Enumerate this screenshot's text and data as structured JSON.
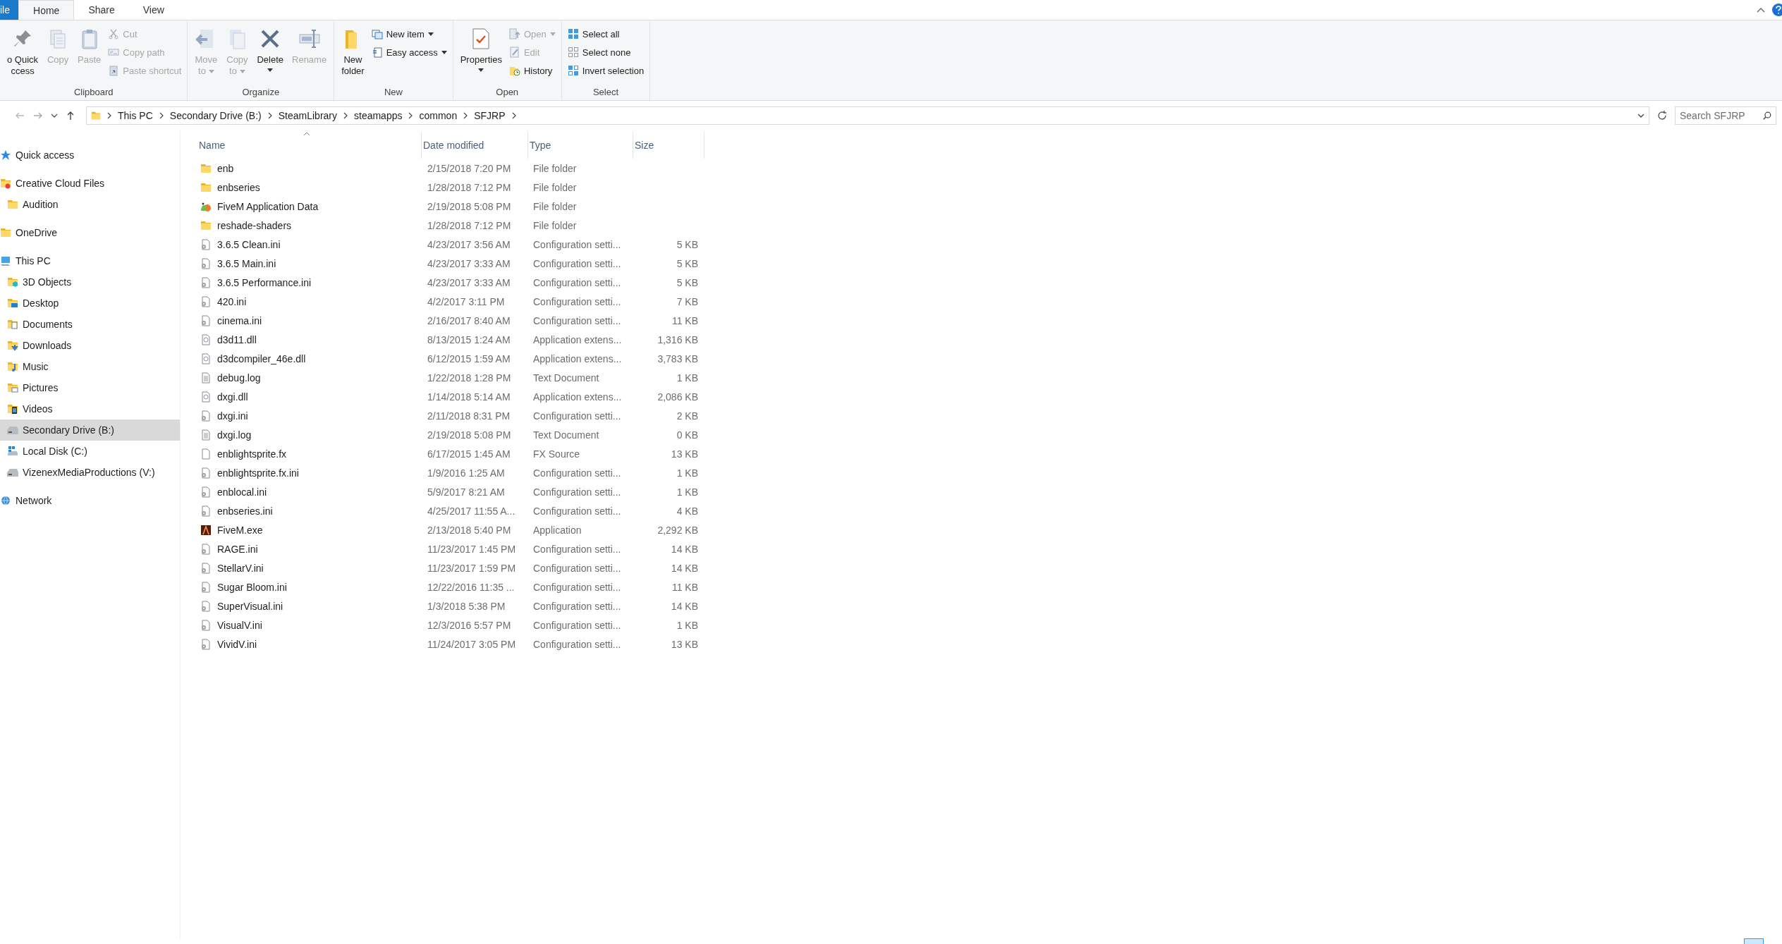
{
  "ribbon": {
    "tabs": [
      {
        "label": "ile",
        "kind": "file",
        "selected": false
      },
      {
        "label": "Home",
        "kind": "tab",
        "selected": true
      },
      {
        "label": "Share",
        "kind": "tab",
        "selected": false
      },
      {
        "label": "View",
        "kind": "tab",
        "selected": false
      }
    ],
    "groups": [
      {
        "label": "Clipboard",
        "items": [
          {
            "kind": "large",
            "lines": [
              "o Quick",
              "ccess"
            ],
            "disabled": false,
            "dropdown": false
          },
          {
            "kind": "large",
            "lines": [
              "Copy"
            ],
            "disabled": true,
            "dropdown": false
          },
          {
            "kind": "large",
            "lines": [
              "Paste"
            ],
            "disabled": true,
            "dropdown": false
          },
          {
            "kind": "small",
            "lines": [
              "Cut"
            ],
            "disabled": true,
            "dropdown": false
          },
          {
            "kind": "small",
            "lines": [
              "Copy path"
            ],
            "disabled": true,
            "dropdown": false
          },
          {
            "kind": "small",
            "lines": [
              "Paste shortcut"
            ],
            "disabled": true,
            "dropdown": false
          }
        ]
      },
      {
        "label": "Organize",
        "items": [
          {
            "kind": "large",
            "lines": [
              "Move",
              "to"
            ],
            "disabled": true,
            "dropdown": true
          },
          {
            "kind": "large",
            "lines": [
              "Copy",
              "to"
            ],
            "disabled": true,
            "dropdown": true
          },
          {
            "kind": "large",
            "lines": [
              "Delete"
            ],
            "disabled": false,
            "dropdown": true
          },
          {
            "kind": "large",
            "lines": [
              "Rename"
            ],
            "disabled": true,
            "dropdown": false
          }
        ]
      },
      {
        "label": "New",
        "items": [
          {
            "kind": "large",
            "lines": [
              "New",
              "folder"
            ],
            "disabled": false,
            "dropdown": false
          },
          {
            "kind": "small",
            "lines": [
              "New item"
            ],
            "disabled": false,
            "dropdown": true
          },
          {
            "kind": "small",
            "lines": [
              "Easy access"
            ],
            "disabled": false,
            "dropdown": true
          }
        ]
      },
      {
        "label": "Open",
        "items": [
          {
            "kind": "large",
            "lines": [
              "Properties"
            ],
            "disabled": false,
            "dropdown": true
          },
          {
            "kind": "small",
            "lines": [
              "Open"
            ],
            "disabled": true,
            "dropdown": true
          },
          {
            "kind": "small",
            "lines": [
              "Edit"
            ],
            "disabled": true,
            "dropdown": false
          },
          {
            "kind": "small",
            "lines": [
              "History"
            ],
            "disabled": false,
            "dropdown": false
          }
        ]
      },
      {
        "label": "Select",
        "items": [
          {
            "kind": "small",
            "lines": [
              "Select all"
            ],
            "disabled": false,
            "dropdown": false
          },
          {
            "kind": "small",
            "lines": [
              "Select none"
            ],
            "disabled": false,
            "dropdown": false
          },
          {
            "kind": "small",
            "lines": [
              "Invert selection"
            ],
            "disabled": false,
            "dropdown": false
          }
        ]
      }
    ]
  },
  "address": {
    "crumbs": [
      "This PC",
      "Secondary Drive (B:)",
      "SteamLibrary",
      "steamapps",
      "common",
      "SFJRP"
    ],
    "search_placeholder": "Search SFJRP"
  },
  "sidebar": {
    "items": [
      {
        "label": "Quick access",
        "kind": "star",
        "selected": false
      },
      {
        "label": "Creative Cloud Files",
        "kind": "cc",
        "selected": false,
        "children": [
          {
            "label": "Audition",
            "kind": "folder",
            "selected": false
          }
        ]
      },
      {
        "label": "OneDrive",
        "kind": "folder",
        "selected": false
      },
      {
        "label": "This PC",
        "kind": "pc",
        "selected": false,
        "children": [
          {
            "label": "3D Objects",
            "kind": "objects",
            "selected": false
          },
          {
            "label": "Desktop",
            "kind": "desktop",
            "selected": false
          },
          {
            "label": "Documents",
            "kind": "documents",
            "selected": false
          },
          {
            "label": "Downloads",
            "kind": "downloads",
            "selected": false
          },
          {
            "label": "Music",
            "kind": "music",
            "selected": false
          },
          {
            "label": "Pictures",
            "kind": "pictures",
            "selected": false
          },
          {
            "label": "Videos",
            "kind": "videos",
            "selected": false
          },
          {
            "label": "Secondary Drive (B:)",
            "kind": "drive",
            "selected": true
          },
          {
            "label": "Local Disk (C:)",
            "kind": "windrive",
            "selected": false
          },
          {
            "label": "VizenexMediaProductions (V:)",
            "kind": "drive",
            "selected": false
          }
        ]
      },
      {
        "label": "Network",
        "kind": "network",
        "selected": false
      }
    ]
  },
  "table": {
    "columns": [
      {
        "label": "Name",
        "sorted": true
      },
      {
        "label": "Date modified",
        "sorted": false
      },
      {
        "label": "Type",
        "sorted": false
      },
      {
        "label": "Size",
        "sorted": false
      }
    ],
    "rows": [
      {
        "name": "enb",
        "date": "2/15/2018 7:20 PM",
        "type": "File folder",
        "kind": "folder"
      },
      {
        "name": "enbseries",
        "date": "1/28/2018 7:12 PM",
        "type": "File folder",
        "kind": "folder"
      },
      {
        "name": "FiveM Application Data",
        "date": "2/19/2018 5:08 PM",
        "type": "File folder",
        "kind": "appfolder"
      },
      {
        "name": "reshade-shaders",
        "date": "1/28/2018 7:12 PM",
        "type": "File folder",
        "kind": "folder"
      },
      {
        "name": "3.6.5 Clean.ini",
        "date": "4/23/2017 3:56 AM",
        "type": "Configuration setti...",
        "size": "5 KB",
        "kind": "ini"
      },
      {
        "name": "3.6.5 Main.ini",
        "date": "4/23/2017 3:33 AM",
        "type": "Configuration setti...",
        "size": "5 KB",
        "kind": "ini"
      },
      {
        "name": "3.6.5 Performance.ini",
        "date": "4/23/2017 3:33 AM",
        "type": "Configuration setti...",
        "size": "5 KB",
        "kind": "ini"
      },
      {
        "name": "420.ini",
        "date": "4/2/2017 3:11 PM",
        "type": "Configuration setti...",
        "size": "7 KB",
        "kind": "ini"
      },
      {
        "name": "cinema.ini",
        "date": "2/16/2017 8:40 AM",
        "type": "Configuration setti...",
        "size": "11 KB",
        "kind": "ini"
      },
      {
        "name": "d3d11.dll",
        "date": "8/13/2015 1:24 AM",
        "type": "Application extens...",
        "size": "1,316 KB",
        "kind": "dll"
      },
      {
        "name": "d3dcompiler_46e.dll",
        "date": "6/12/2015 1:59 AM",
        "type": "Application extens...",
        "size": "3,783 KB",
        "kind": "dll"
      },
      {
        "name": "debug.log",
        "date": "1/22/2018 1:28 PM",
        "type": "Text Document",
        "size": "1 KB",
        "kind": "text"
      },
      {
        "name": "dxgi.dll",
        "date": "1/14/2018 5:14 AM",
        "type": "Application extens...",
        "size": "2,086 KB",
        "kind": "dll"
      },
      {
        "name": "dxgi.ini",
        "date": "2/11/2018 8:31 PM",
        "type": "Configuration setti...",
        "size": "2 KB",
        "kind": "ini"
      },
      {
        "name": "dxgi.log",
        "date": "2/19/2018 5:08 PM",
        "type": "Text Document",
        "size": "0 KB",
        "kind": "text"
      },
      {
        "name": "enblightsprite.fx",
        "date": "6/17/2015 1:45 AM",
        "type": "FX Source",
        "size": "13 KB",
        "kind": "blank"
      },
      {
        "name": "enblightsprite.fx.ini",
        "date": "1/9/2016 1:25 AM",
        "type": "Configuration setti...",
        "size": "1 KB",
        "kind": "ini"
      },
      {
        "name": "enblocal.ini",
        "date": "5/9/2017 8:21 AM",
        "type": "Configuration setti...",
        "size": "1 KB",
        "kind": "ini"
      },
      {
        "name": "enbseries.ini",
        "date": "4/25/2017 11:55 A...",
        "type": "Configuration setti...",
        "size": "4 KB",
        "kind": "ini"
      },
      {
        "name": "FiveM.exe",
        "date": "2/13/2018 5:40 PM",
        "type": "Application",
        "size": "2,292 KB",
        "kind": "exe"
      },
      {
        "name": "RAGE.ini",
        "date": "11/23/2017 1:45 PM",
        "type": "Configuration setti...",
        "size": "14 KB",
        "kind": "ini"
      },
      {
        "name": "StellarV.ini",
        "date": "11/23/2017 1:59 PM",
        "type": "Configuration setti...",
        "size": "14 KB",
        "kind": "ini"
      },
      {
        "name": "Sugar Bloom.ini",
        "date": "12/22/2016 11:35 ...",
        "type": "Configuration setti...",
        "size": "11 KB",
        "kind": "ini"
      },
      {
        "name": "SuperVisual.ini",
        "date": "1/3/2018 5:38 PM",
        "type": "Configuration setti...",
        "size": "14 KB",
        "kind": "ini"
      },
      {
        "name": "VisualV.ini",
        "date": "12/3/2016 5:57 PM",
        "type": "Configuration setti...",
        "size": "1 KB",
        "kind": "ini"
      },
      {
        "name": "VividV.ini",
        "date": "11/24/2017 3:05 PM",
        "type": "Configuration setti...",
        "size": "13 KB",
        "kind": "ini"
      }
    ]
  }
}
